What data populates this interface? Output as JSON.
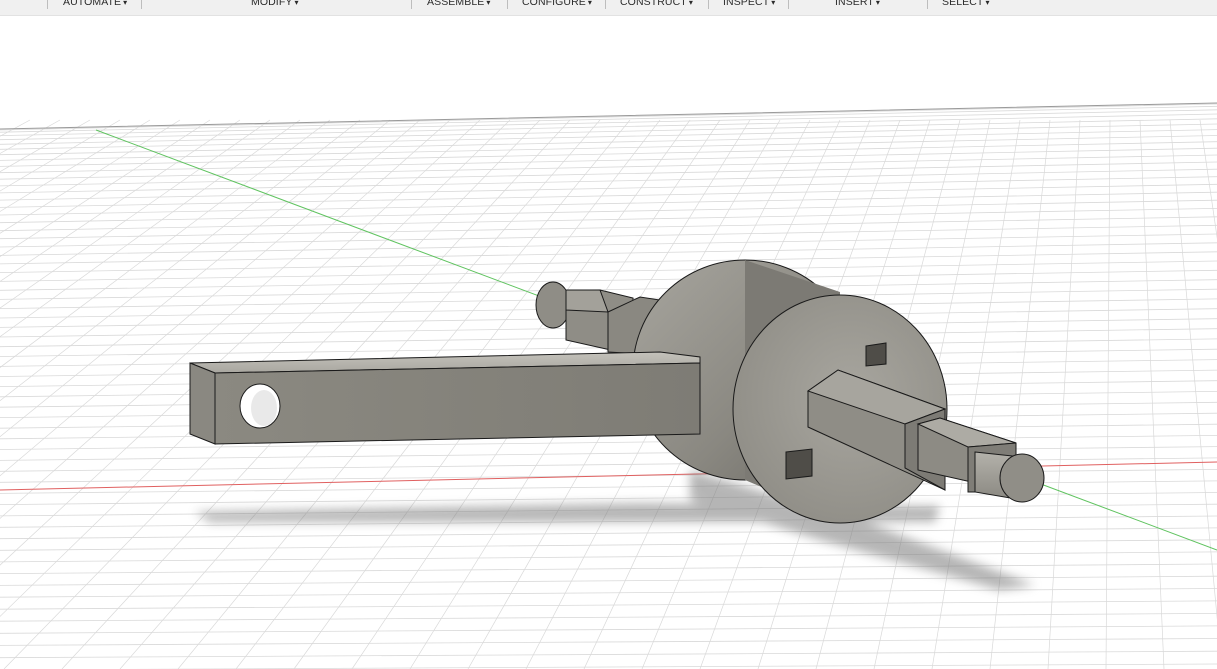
{
  "toolbar": {
    "menus": [
      {
        "label": "AUTOMATE"
      },
      {
        "label": "MODIFY"
      },
      {
        "label": "ASSEMBLE"
      },
      {
        "label": "CONFIGURE"
      },
      {
        "label": "CONSTRUCT"
      },
      {
        "label": "INSPECT"
      },
      {
        "label": "INSERT"
      },
      {
        "label": "SELECT"
      }
    ],
    "caret": "▾"
  },
  "viewport": {
    "background": "#ffffff",
    "grid_color": "#d9d9d9",
    "x_axis_color": "#e06060",
    "y_axis_color": "#5fc35f",
    "model_color": "#8f8d86",
    "model_edge_color": "#1a1a1a"
  }
}
